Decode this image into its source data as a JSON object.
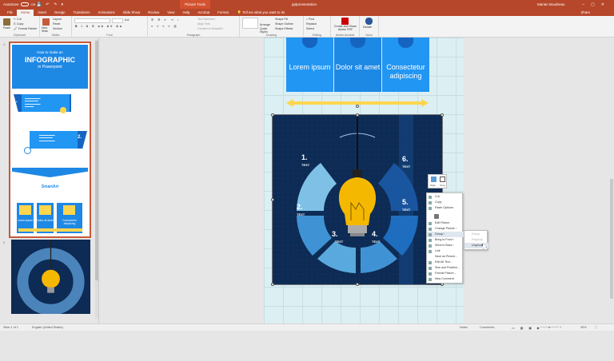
{
  "title_bar": {
    "autosave": "AutoSave",
    "autosave_state": "Off",
    "context_tab": "Picture Tools",
    "file_name": "pptpresentation",
    "user": "Marian Boudreau"
  },
  "tabs": [
    "File",
    "Home",
    "Insert",
    "Design",
    "Transitions",
    "Animations",
    "Slide Show",
    "Review",
    "View",
    "Help",
    "Acrobat",
    "Format"
  ],
  "active_tab": "Home",
  "tell_me": "Tell me what you want to do",
  "share": "Share",
  "ribbon": {
    "clipboard": {
      "label": "Clipboard",
      "paste": "Paste",
      "cut": "Cut",
      "copy": "Copy",
      "format_painter": "Format Painter"
    },
    "slides": {
      "label": "Slides",
      "new_slide": "New Slide",
      "layout": "Layout",
      "reset": "Reset",
      "section": "Section"
    },
    "font": {
      "label": "Font"
    },
    "paragraph": {
      "label": "Paragraph",
      "text_direction": "Text Direction",
      "align_text": "Align Text",
      "convert": "Convert to SmartArt"
    },
    "drawing": {
      "label": "Drawing",
      "arrange": "Arrange",
      "quick_styles": "Quick Styles",
      "shape_fill": "Shape Fill",
      "shape_outline": "Shape Outline",
      "shape_effects": "Shape Effects"
    },
    "editing": {
      "label": "Editing",
      "find": "Find",
      "replace": "Replace",
      "select": "Select"
    },
    "adobe": {
      "label": "Adobe Acrobat",
      "create": "Create and Share Adobe PDF"
    },
    "voice": {
      "label": "Voice",
      "dictate": "Dictate"
    }
  },
  "thumbnails": {
    "slide1": {
      "num": "1",
      "line1": "How to make an",
      "line2": "INFOGRAPHIC",
      "line3": "in Powerpoint",
      "num2": "2.",
      "smartart": "SmartArt",
      "col1": "Lorem ipsum",
      "col2": "Dolor sit amet",
      "col3": "Consectetur adipiscing"
    },
    "slide2": {
      "num": "2"
    }
  },
  "canvas": {
    "columns": [
      "Lorem ipsum",
      "Dolor sit amet",
      "Consectetur adipiscing"
    ],
    "segments": [
      {
        "num": "1.",
        "label": "TEXT"
      },
      {
        "num": "2.",
        "label": "TEXT"
      },
      {
        "num": "3.",
        "label": "TEXT"
      },
      {
        "num": "4.",
        "label": "TEXT"
      },
      {
        "num": "5.",
        "label": "TEXT"
      },
      {
        "num": "6.",
        "label": "TEXT"
      }
    ]
  },
  "layout_options": {
    "style": "Style",
    "crop": "Crop"
  },
  "context_menu": [
    "Cut",
    "Copy",
    "Paste Options:",
    "",
    "Edit Picture",
    "Change Picture",
    "Group",
    "Bring to Front",
    "Send to Back",
    "Link",
    "Save as Picture...",
    "Edit Alt Text...",
    "Size and Position...",
    "Format Picture...",
    "New Comment"
  ],
  "submenu": [
    "Group",
    "Regroup",
    "Ungroup"
  ],
  "status": {
    "slide": "Slide 1 of 1",
    "language": "English (United States)",
    "notes": "Notes",
    "comments": "Comments",
    "zoom": "39%"
  }
}
